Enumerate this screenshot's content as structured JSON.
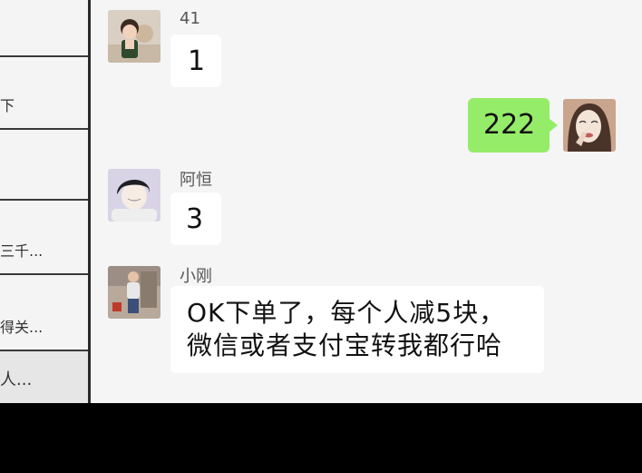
{
  "sidebar": {
    "rows": [
      {
        "snippet": ""
      },
      {
        "snippet": "下"
      },
      {
        "snippet": ""
      },
      {
        "snippet": "三千..."
      },
      {
        "snippet": "得关..."
      },
      {
        "snippet": "人..."
      }
    ]
  },
  "chat": {
    "messages": [
      {
        "sender": "41",
        "text": "1"
      },
      {
        "sender": "",
        "text": "222"
      },
      {
        "sender": "阿恒",
        "text": "3"
      },
      {
        "sender": "小刚",
        "line1": "OK下单了，每个人减5块，",
        "line2": "微信或者支付宝转我都行哈"
      }
    ]
  },
  "colors": {
    "background": "#f5f5f5",
    "self_bubble": "#95ec69",
    "other_bubble": "#ffffff",
    "bottom_bar": "#000000"
  }
}
